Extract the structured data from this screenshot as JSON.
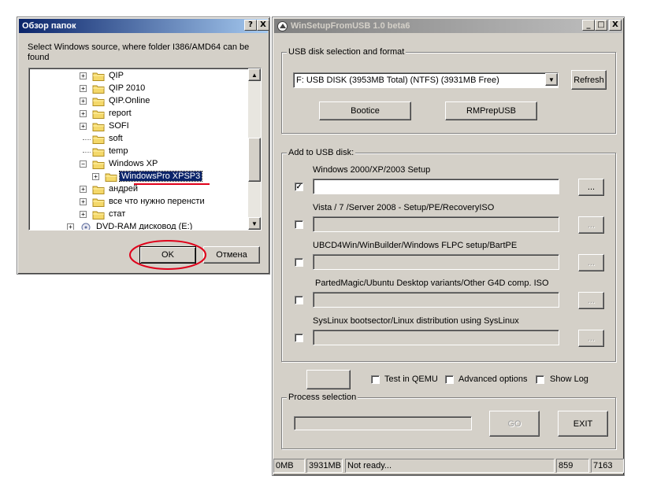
{
  "browse": {
    "title": "Обзор папок",
    "help_btn": "?",
    "close_btn": "X",
    "description": "Select Windows source, where folder I386/AMD64 can be found",
    "tree": [
      {
        "label": "QIP",
        "expandable": true,
        "selected": false
      },
      {
        "label": "QIP 2010",
        "expandable": true,
        "selected": false
      },
      {
        "label": "QIP.Online",
        "expandable": true,
        "selected": false
      },
      {
        "label": "report",
        "expandable": true,
        "selected": false
      },
      {
        "label": "SOFI",
        "expandable": true,
        "selected": false
      },
      {
        "label": "soft",
        "expandable": false,
        "selected": false
      },
      {
        "label": "temp",
        "expandable": false,
        "selected": false
      },
      {
        "label": "Windows XP",
        "expandable": true,
        "expanded": true,
        "selected": false
      },
      {
        "label": "WindowsPro XPSP3",
        "expandable": true,
        "selected": true
      },
      {
        "label": "андрей",
        "expandable": true,
        "selected": false
      },
      {
        "label": "все что нужно перенсти",
        "expandable": true,
        "selected": false
      },
      {
        "label": "стат",
        "expandable": true,
        "selected": false
      },
      {
        "label": "DVD-RAM дисковод (E:)",
        "expandable": true,
        "selected": false
      }
    ],
    "ok_label": "OK",
    "cancel_label": "Отмена"
  },
  "main": {
    "title": "WinSetupFromUSB 1.0 beta6",
    "usb_group": "USB disk selection and format",
    "disk_selected": "F: USB DISK (3953MB Total) (NTFS) (3931MB Free)",
    "refresh_label": "Refresh",
    "bootice_label": "Bootice",
    "rmprep_label": "RMPrepUSB",
    "add_group": "Add to USB disk:",
    "sources": [
      {
        "label": "Windows 2000/XP/2003 Setup",
        "checked": true,
        "value": "",
        "browse": "..."
      },
      {
        "label": "Vista / 7 /Server 2008 - Setup/PE/RecoveryISO",
        "checked": false,
        "value": "",
        "browse": "..."
      },
      {
        "label": "UBCD4Win/WinBuilder/Windows FLPC setup/BartPE",
        "checked": false,
        "value": "",
        "browse": "..."
      },
      {
        "label": "PartedMagic/Ubuntu Desktop variants/Other G4D comp. ISO",
        "checked": false,
        "value": "",
        "browse": "..."
      },
      {
        "label": "SysLinux bootsector/Linux distribution using SysLinux",
        "checked": false,
        "value": "",
        "browse": "..."
      }
    ],
    "test_qemu_label": "Test in QEMU",
    "advanced_label": "Advanced options",
    "showlog_label": "Show Log",
    "process_group": "Process selection",
    "go_label": "GO",
    "exit_label": "EXIT",
    "status": [
      "0MB",
      "3931MB",
      "Not ready...",
      "859",
      "7163"
    ]
  },
  "annotations": {
    "highlight_color": "#e0001a"
  }
}
